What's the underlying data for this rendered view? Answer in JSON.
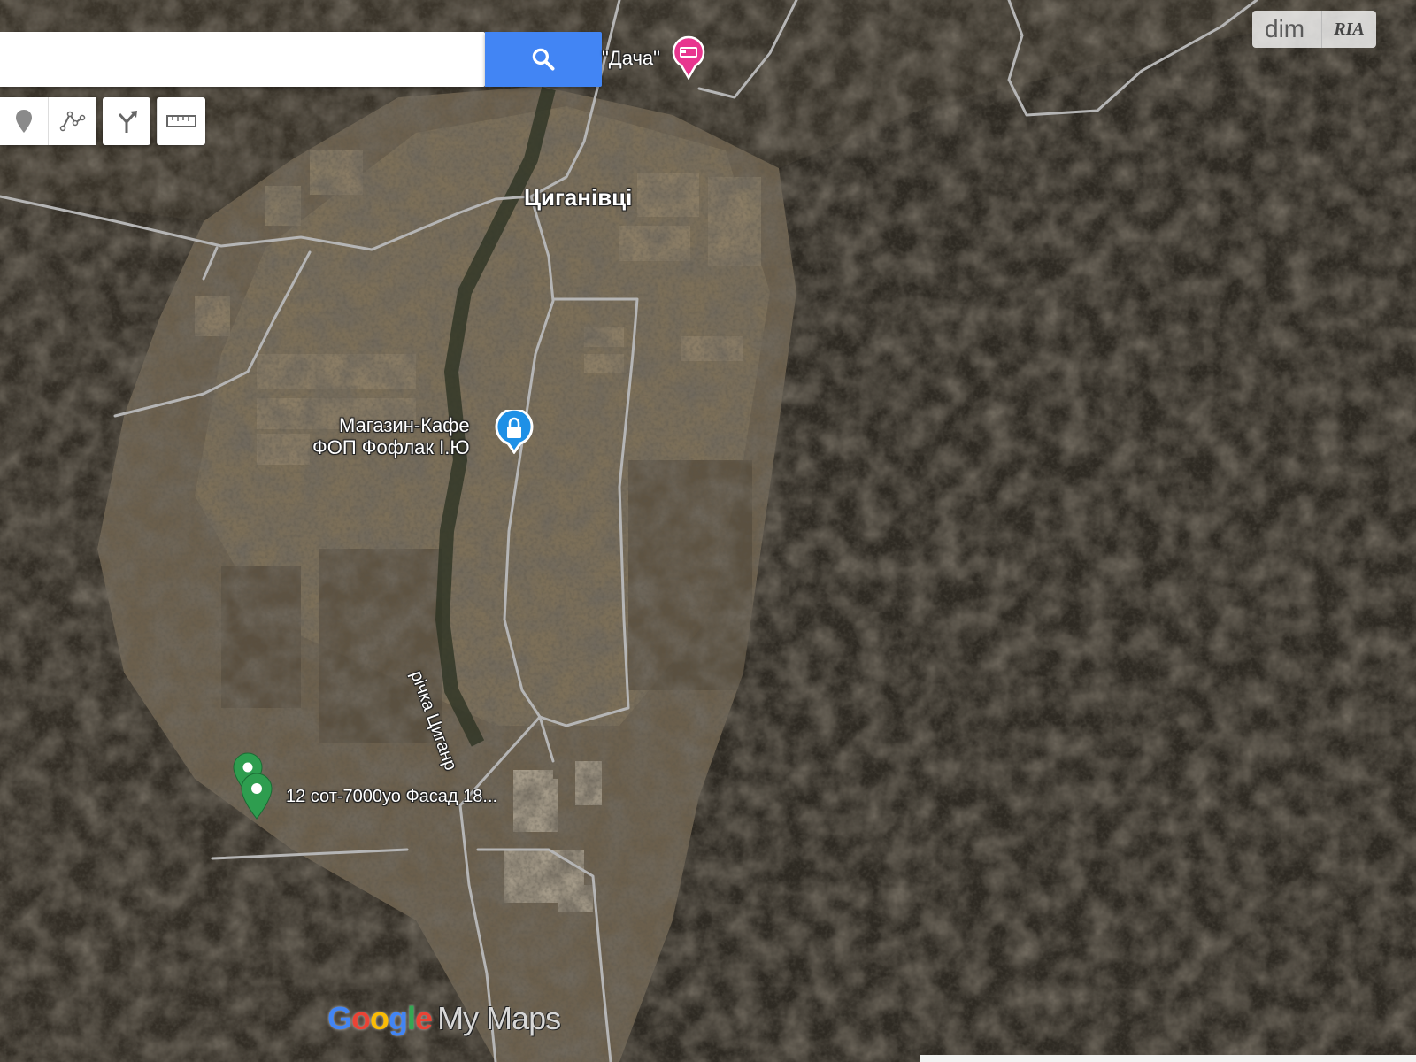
{
  "search": {
    "placeholder": "",
    "value": ""
  },
  "toolbar": {
    "tools": [
      "marker-icon",
      "draw-line-icon",
      "directions-icon",
      "ruler-icon"
    ]
  },
  "places": {
    "village": "Циганівці",
    "dacha": "\"Дача\"",
    "shop_line1": "Магазин-Кафе",
    "shop_line2": "ФОП Фофлак І.Ю",
    "river": "річка Циганр",
    "plot": "12 сот-7000уо Фасад 18..."
  },
  "watermark": {
    "left": "dim",
    "right": "RIA"
  },
  "branding": {
    "google": "Google",
    "product": "My Maps"
  },
  "colors": {
    "search_button": "#4285f4",
    "plot_pin": "#2e9d4f",
    "shop_pin": "#1e90e6",
    "lodging_pin": "#e8368f",
    "road": "#b8b8b8"
  },
  "map_type": "satellite"
}
